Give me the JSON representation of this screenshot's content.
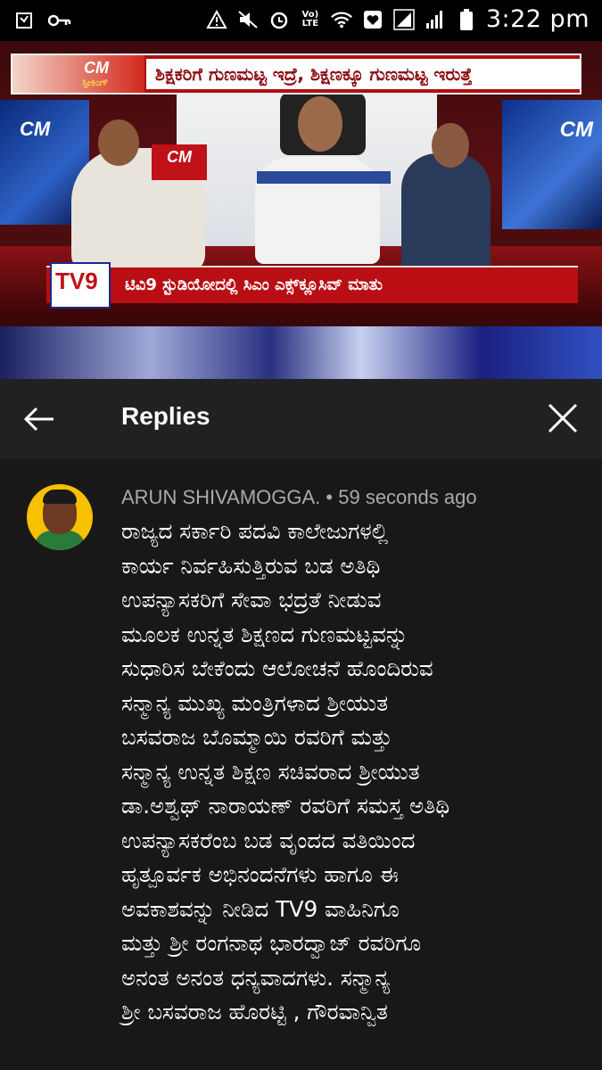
{
  "status_bar": {
    "time": "3:22 pm",
    "network": "Vo) LTE",
    "left_icons": [
      "clipboard-icon",
      "key-icon"
    ],
    "right_icons": [
      "airplane-alert-icon",
      "mute-icon",
      "alarm-icon",
      "volte-icon",
      "wifi-icon",
      "heart-box-icon",
      "signal-icon",
      "signal-icon",
      "battery-icon"
    ]
  },
  "video": {
    "headline": "ಶಿಕ್ಷಕರಿಗೆ ಗುಣಮಟ್ಟ ಇದ್ರೆ, ಶಿಕ್ಷಣಕ್ಕೂ ಗುಣಮಟ್ಟ ಇರುತ್ತೆ",
    "cm_badge": "CM",
    "cm_sub": "ಸ್ಪೀಕಿಂಗ್",
    "channel_logo": "TV9",
    "ticker": "ಟಿವಿ9 ಸ್ಟುಡಿಯೋದಲ್ಲಿ ಸಿಎಂ ಎಕ್ಸ್‌ಕ್ಲೂಸಿವ್ ಮಾತು"
  },
  "replies_header": {
    "title": "Replies"
  },
  "comment": {
    "author": "ARUN SHIVAMOGGA.",
    "separator": " • ",
    "timestamp": "59 seconds ago",
    "lines": [
      "ರಾಜ್ಯದ ಸರ್ಕಾರಿ ಪದವಿ ಕಾಲೇಜುಗಳಲ್ಲಿ",
      "ಕಾರ್ಯ ನಿರ್ವಹಿಸುತ್ತಿರುವ ಬಡ ಅತಿಥಿ",
      "ಉಪನ್ಯಾಸಕರಿಗೆ ಸೇವಾ ಭದ್ರತೆ ನೀಡುವ",
      "ಮೂಲಕ ಉನ್ನತ ಶಿಕ್ಷಣದ ಗುಣಮಟ್ಟವನ್ನು",
      "ಸುಧಾರಿಸ ಬೇಕೆಂದು ಆಲೋಚನೆ ಹೊಂದಿರುವ",
      "ಸನ್ಮಾನ್ಯ ಮುಖ್ಯ ಮಂತ್ರಿಗಳಾದ ಶ್ರೀಯುತ",
      "ಬಸವರಾಜ ಬೊಮ್ಮಾಯಿ ರವರಿಗೆ ಮತ್ತು",
      "ಸನ್ಮಾನ್ಯ ಉನ್ನತ ಶಿಕ್ಷಣ ಸಚಿವರಾದ ಶ್ರೀಯುತ",
      "ಡಾ.ಅಶ್ವಥ್ ನಾರಾಯಣ್ ರವರಿಗೆ ಸಮಸ್ತ ಅತಿಥಿ",
      "ಉಪನ್ಯಾಸಕರೆಂಬ ಬಡ ವೃಂದದ ವತಿಯಿಂದ",
      "ಹೃತ್ಪೂರ್ವಕ ಅಭಿನಂದನೆಗಳು ಹಾಗೂ ಈ",
      "ಅವಕಾಶವನ್ನು ನೀಡಿದ TV9 ವಾಹಿನಿಗೂ",
      "ಮತ್ತು ಶ್ರೀ ರಂಗನಾಥ ಭಾರದ್ವಾಜ್ ರವರಿಗೂ",
      "ಅನಂತ ಅನಂತ ಧನ್ಯವಾದಗಳು. ಸನ್ಮಾನ್ಯ",
      "ಶ್ರೀ ಬಸವರಾಜ ಹೊರಟ್ಟಿ , ಗೌರವಾನ್ವಿತ"
    ]
  },
  "colors": {
    "background": "#181818",
    "header_bg": "#212121",
    "meta_text": "#aaaaaa",
    "tv9_red": "#b80e14"
  }
}
